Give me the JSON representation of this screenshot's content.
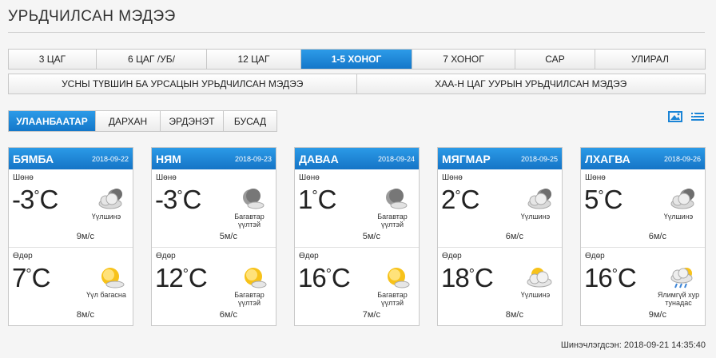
{
  "page": {
    "title": "УРЬДЧИЛСАН МЭДЭЭ"
  },
  "tabs": [
    "3 ЦАГ",
    "6 ЦАГ /УБ/",
    "12 ЦАГ",
    "1-5 ХОНОГ",
    "7 ХОНОГ",
    "САР",
    "УЛИРАЛ"
  ],
  "tabs2": [
    "УСНЫ ТҮВШИН БА УРСАЦЫН УРЬДЧИЛСАН МЭДЭЭ",
    "ХАА-Н ЦАГ УУРЫН УРЬДЧИЛСАН МЭДЭЭ"
  ],
  "cities": [
    "УЛААНБААТАР",
    "ДАРХАН",
    "ЭРДЭНЭТ",
    "БУСАД"
  ],
  "view_icons": [
    "image-view-icon",
    "list-view-icon"
  ],
  "labels": {
    "night": "Шөнө",
    "day": "Өдөр",
    "unit": "C"
  },
  "forecast": [
    {
      "day": "БЯМБА",
      "date": "2018-09-22",
      "night": {
        "temp": "-3",
        "cond": "Үүлшинэ",
        "icon": "cloud-moon-icon",
        "wind": "9м/с"
      },
      "daytime": {
        "temp": "7",
        "cond": "Үүл багасна",
        "icon": "sun-cloud-icon",
        "wind": "8м/с"
      }
    },
    {
      "day": "НЯМ",
      "date": "2018-09-23",
      "night": {
        "temp": "-3",
        "cond": "Багавтар үүлтэй",
        "icon": "moon-cloud-icon",
        "wind": "5м/с"
      },
      "daytime": {
        "temp": "12",
        "cond": "Багавтар үүлтэй",
        "icon": "sun-small-cloud-icon",
        "wind": "6м/с"
      }
    },
    {
      "day": "ДАВАА",
      "date": "2018-09-24",
      "night": {
        "temp": "1",
        "cond": "Багавтар үүлтэй",
        "icon": "moon-cloud-icon",
        "wind": "5м/с"
      },
      "daytime": {
        "temp": "16",
        "cond": "Багавтар үүлтэй",
        "icon": "sun-small-cloud-icon",
        "wind": "7м/с"
      }
    },
    {
      "day": "МЯГМАР",
      "date": "2018-09-25",
      "night": {
        "temp": "2",
        "cond": "Үүлшинэ",
        "icon": "cloud-moon-icon",
        "wind": "6м/с"
      },
      "daytime": {
        "temp": "18",
        "cond": "Үүлшинэ",
        "icon": "cloud-sun-icon",
        "wind": "8м/с"
      }
    },
    {
      "day": "ЛХАГВА",
      "date": "2018-09-26",
      "night": {
        "temp": "5",
        "cond": "Үүлшинэ",
        "icon": "cloud-moon-icon",
        "wind": "6м/с"
      },
      "daytime": {
        "temp": "16",
        "cond": "Ялимгүй хур тунадас",
        "icon": "rain-cloud-sun-icon",
        "wind": "9м/с"
      }
    }
  ],
  "footer": {
    "updated": "Шинэчлэгдсэн: 2018-09-21 14:35:40"
  },
  "colors": {
    "accent": "#1a84d6"
  }
}
